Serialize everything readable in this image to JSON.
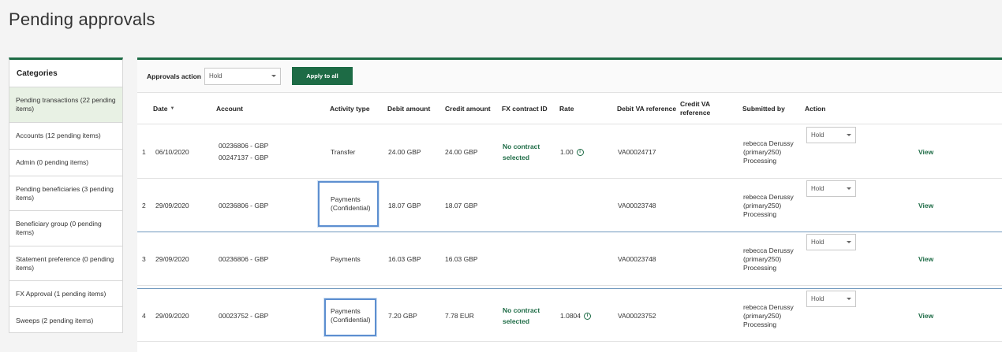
{
  "page_title": "Pending approvals",
  "sidebar": {
    "header": "Categories",
    "items": [
      {
        "label": "Pending transactions (22 pending items)"
      },
      {
        "label": "Accounts (12 pending items)"
      },
      {
        "label": "Admin (0 pending items)"
      },
      {
        "label": "Pending beneficiaries (3 pending items)"
      },
      {
        "label": "Beneficiary group (0 pending items)"
      },
      {
        "label": "Statement preference (0 pending items)"
      },
      {
        "label": "FX Approval (1 pending items)"
      },
      {
        "label": "Sweeps (2 pending items)"
      }
    ]
  },
  "toolbar": {
    "approvals_action_label": "Approvals action",
    "approvals_action_value": "Hold",
    "apply_all_label": "Apply to all"
  },
  "table": {
    "columns": {
      "date": "Date",
      "account": "Account",
      "activity_type": "Activity type",
      "debit_amount": "Debit amount",
      "credit_amount": "Credit amount",
      "fx_contract_id": "FX contract ID",
      "rate": "Rate",
      "debit_va_reference": "Debit VA reference",
      "credit_va_reference": "Credit VA reference",
      "submitted_by": "Submitted by",
      "action": "Action"
    },
    "rows": [
      {
        "num": "1",
        "date": "06/10/2020",
        "account_1": "00236806 - GBP",
        "account_2": "00247137 - GBP",
        "activity": "Transfer",
        "debit": "24.00 GBP",
        "credit": "24.00 GBP",
        "fx_contract": "No contract selected",
        "rate": "1.00",
        "debit_va": "VA00024717",
        "credit_va": "",
        "submitted_by": "rebecca Derussy (primary250) Processing",
        "action": "Hold",
        "view": "View"
      },
      {
        "num": "2",
        "date": "29/09/2020",
        "account_1": "00236806 - GBP",
        "account_2": "",
        "activity": "Payments (Confidential)",
        "debit": "18.07 GBP",
        "credit": "18.07 GBP",
        "fx_contract": "",
        "rate": "",
        "debit_va": "VA00023748",
        "credit_va": "",
        "submitted_by": "rebecca Derussy (primary250) Processing",
        "action": "Hold",
        "view": "View"
      },
      {
        "num": "3",
        "date": "29/09/2020",
        "account_1": "00236806 - GBP",
        "account_2": "",
        "activity": "Payments",
        "debit": "16.03 GBP",
        "credit": "16.03 GBP",
        "fx_contract": "",
        "rate": "",
        "debit_va": "VA00023748",
        "credit_va": "",
        "submitted_by": "rebecca Derussy (primary250) Processing",
        "action": "Hold",
        "view": "View"
      },
      {
        "num": "4",
        "date": "29/09/2020",
        "account_1": "00023752 - GBP",
        "account_2": "",
        "activity": "Payments (Confidential)",
        "debit": "7.20 GBP",
        "credit": "7.78 EUR",
        "fx_contract": "No contract selected",
        "rate": "1.0804",
        "debit_va": "VA00023752",
        "credit_va": "",
        "submitted_by": "rebecca Derussy (primary250) Processing",
        "action": "Hold",
        "view": "View"
      }
    ]
  },
  "colors": {
    "brand_green": "#1d6b45",
    "active_category_bg": "#e8f1e4",
    "focus_outline": "#5d8fd0"
  },
  "icons": {
    "sort": "sort-desc-icon",
    "info": "info-icon",
    "dropdown": "chevron-down-icon"
  }
}
